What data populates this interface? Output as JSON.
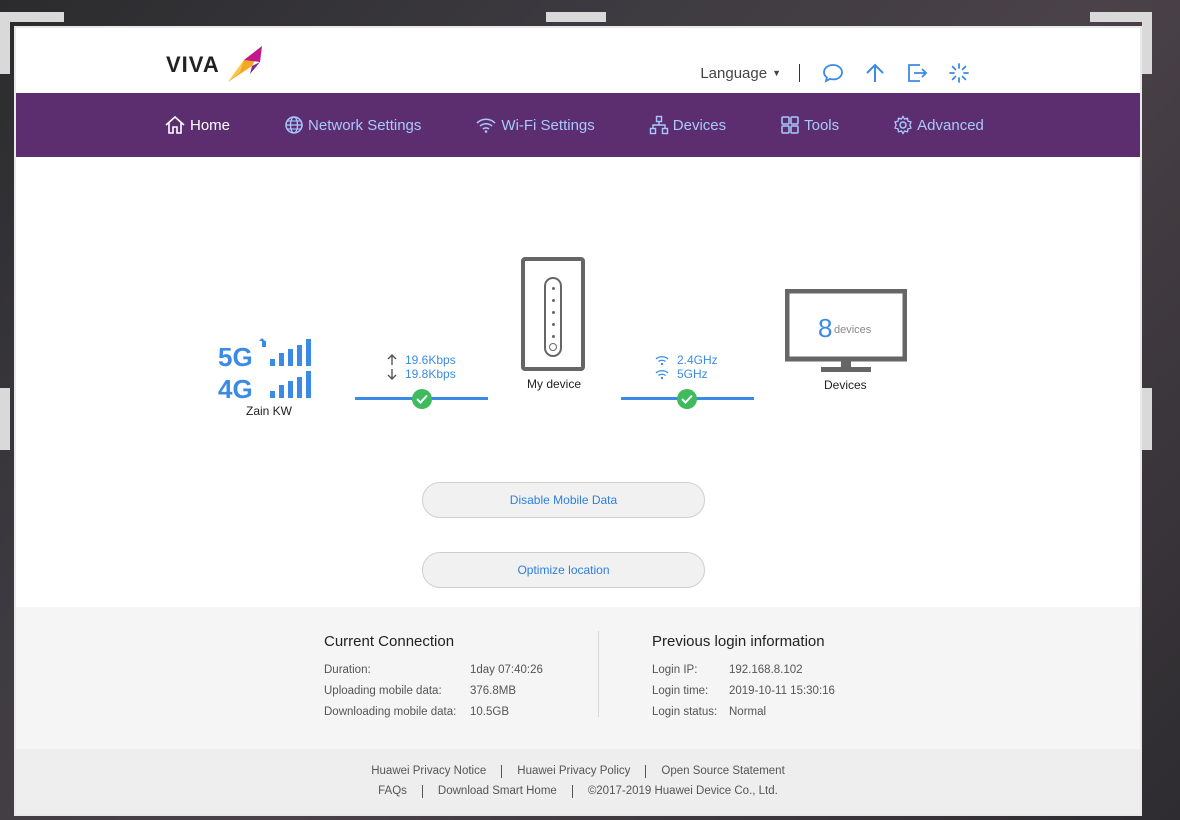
{
  "header": {
    "logo_text": "VIVA",
    "language_label": "Language",
    "icons": [
      "chat-icon",
      "upload-arrow-icon",
      "logout-icon",
      "loading-spinner-icon"
    ]
  },
  "nav": {
    "items": [
      {
        "label": "Home",
        "icon": "home-icon",
        "active": true
      },
      {
        "label": "Network Settings",
        "icon": "globe-icon"
      },
      {
        "label": "Wi-Fi Settings",
        "icon": "wifi-icon"
      },
      {
        "label": "Devices",
        "icon": "devices-network-icon"
      },
      {
        "label": "Tools",
        "icon": "tools-grid-icon"
      },
      {
        "label": "Advanced",
        "icon": "gear-icon"
      }
    ]
  },
  "status": {
    "network_badge": {
      "top": "5G",
      "bottom": "4G"
    },
    "carrier": "Zain KW",
    "upload_speed": "19.6Kbps",
    "download_speed": "19.8Kbps",
    "device_label": "My device",
    "band_24": "2.4GHz",
    "band_5": "5GHz",
    "devices_count": "8",
    "devices_unit": "devices",
    "devices_label": "Devices"
  },
  "buttons": {
    "disable_mobile_data": "Disable Mobile Data",
    "optimize_location": "Optimize location"
  },
  "current_connection": {
    "title": "Current Connection",
    "rows": [
      {
        "key": "Duration:",
        "value": "1day 07:40:26"
      },
      {
        "key": "Uploading mobile data:",
        "value": "376.8MB"
      },
      {
        "key": "Downloading mobile data:",
        "value": "10.5GB"
      }
    ]
  },
  "previous_login": {
    "title": "Previous login information",
    "rows": [
      {
        "key": "Login IP:",
        "value": "192.168.8.102"
      },
      {
        "key": "Login time:",
        "value": "2019-10-11 15:30:16"
      },
      {
        "key": "Login status:",
        "value": "Normal"
      }
    ]
  },
  "footer": {
    "row1": [
      "Huawei Privacy Notice",
      "Huawei Privacy Policy",
      "Open Source Statement"
    ],
    "row2": [
      "FAQs",
      "Download Smart Home",
      "©2017-2019 Huawei Device Co., Ltd."
    ]
  },
  "colors": {
    "nav_bg": "#5c2e6f",
    "accent_blue": "#3b8be6",
    "success_green": "#3fba5c"
  }
}
